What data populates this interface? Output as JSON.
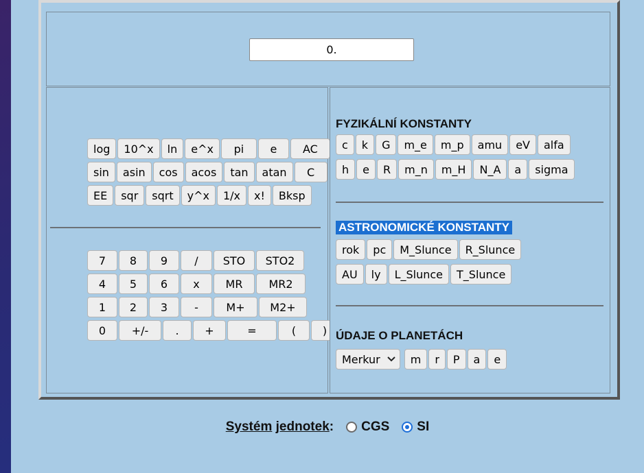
{
  "display": {
    "value": "0."
  },
  "function_rows": [
    [
      "log",
      "10^x",
      "ln",
      "e^x",
      "pi",
      "e",
      "AC"
    ],
    [
      "sin",
      "asin",
      "cos",
      "acos",
      "tan",
      "atan",
      "C"
    ],
    [
      "EE",
      "sqr",
      "sqrt",
      "y^x",
      "1/x",
      "x!",
      "Bksp"
    ]
  ],
  "numeric_rows": [
    [
      "7",
      "8",
      "9",
      "/",
      "STO",
      "STO2"
    ],
    [
      "4",
      "5",
      "6",
      "x",
      "MR",
      "MR2"
    ],
    [
      "1",
      "2",
      "3",
      "-",
      "M+",
      "M2+"
    ],
    [
      "0",
      "+/-",
      ".",
      "+",
      "=",
      "(",
      ")"
    ]
  ],
  "physics": {
    "heading": "FYZIKÁLNÍ KONSTANTY",
    "rows": [
      [
        "c",
        "k",
        "G",
        "m_e",
        "m_p",
        "amu",
        "eV",
        "alfa"
      ],
      [
        "h",
        "e",
        "R",
        "m_n",
        "m_H",
        "N_A",
        "a",
        "sigma"
      ]
    ]
  },
  "astro": {
    "heading": "ASTRONOMICKÉ KONSTANTY",
    "rows": [
      [
        "rok",
        "pc",
        "M_Slunce",
        "R_Slunce"
      ],
      [
        "AU",
        "ly",
        "L_Slunce",
        "T_Slunce"
      ]
    ]
  },
  "planets": {
    "heading": "ÚDAJE O PLANETÁCH",
    "selected": "Merkur",
    "buttons": [
      "m",
      "r",
      "P",
      "a",
      "e"
    ]
  },
  "units": {
    "label_u1": "Systém",
    "label_u2": "jednotek",
    "label_colon": ":",
    "option_cgs": "CGS",
    "option_si": "SI",
    "selected": "SI"
  },
  "colors": {
    "panel": "#a8cbe5",
    "highlight": "#1b6fd1",
    "radio_accent": "#1e6fd8"
  }
}
